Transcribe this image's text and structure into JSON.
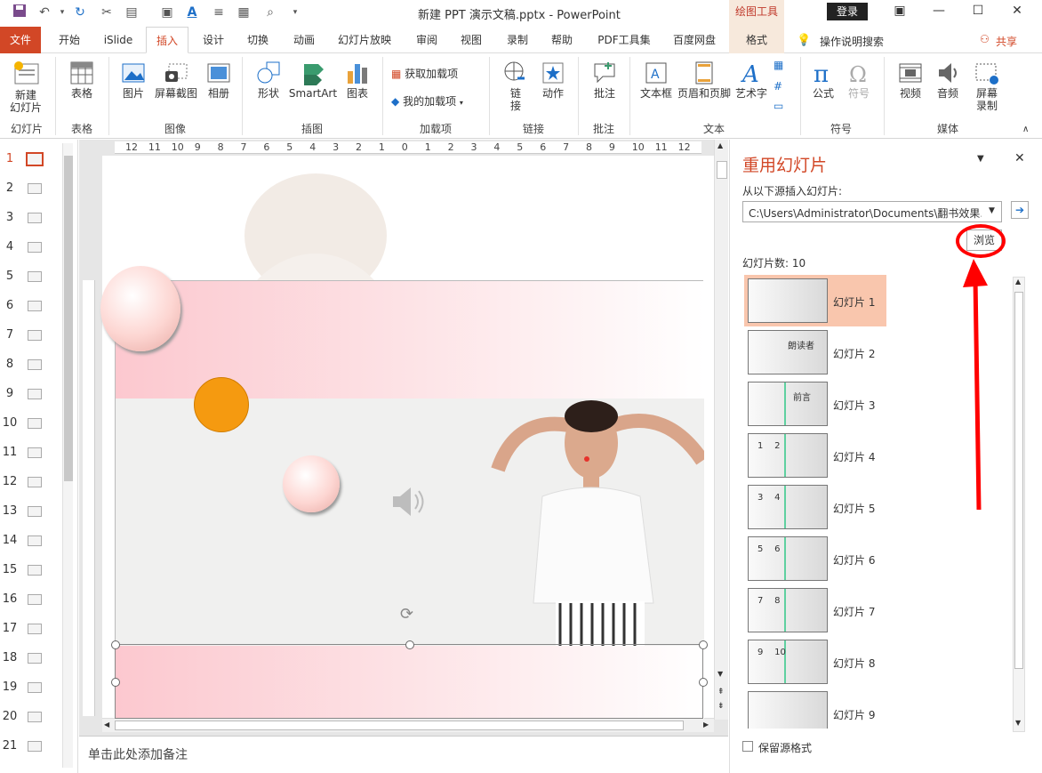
{
  "titlebar": {
    "doc_title": "新建 PPT 演示文稿.pptx  -  PowerPoint",
    "drawing_tools": "绘图工具",
    "login": "登录"
  },
  "tabs": [
    "文件",
    "开始",
    "iSlide",
    "插入",
    "设计",
    "切换",
    "动画",
    "幻灯片放映",
    "审阅",
    "视图",
    "录制",
    "帮助",
    "PDF工具集",
    "百度网盘",
    "格式"
  ],
  "tell_me": "操作说明搜索",
  "share": "共享",
  "ribbon": {
    "new_slide": "新建\n幻灯片",
    "group_slides": "幻灯片",
    "table": "表格",
    "group_table": "表格",
    "picture": "图片",
    "screenshot": "屏幕截图",
    "album": "相册",
    "group_images": "图像",
    "shapes": "形状",
    "smartart": "SmartArt",
    "chart": "图表",
    "group_illustrations": "插图",
    "get_addins": "获取加载项",
    "my_addins": "我的加载项",
    "group_addins": "加载项",
    "link": "链\n接",
    "action": "动作",
    "group_links": "链接",
    "comment": "批注",
    "group_comments": "批注",
    "textbox": "文本框",
    "header_footer": "页眉和页脚",
    "wordart": "艺术字",
    "group_text": "文本",
    "equation": "公式",
    "symbol": "符号",
    "group_symbols": "符号",
    "video": "视频",
    "audio": "音频",
    "screen_rec": "屏幕\n录制",
    "group_media": "媒体"
  },
  "thumbs": [
    "1",
    "2",
    "3",
    "4",
    "5",
    "6",
    "7",
    "8",
    "9",
    "10",
    "11",
    "12",
    "13",
    "14",
    "15",
    "16",
    "17",
    "18",
    "19",
    "20",
    "21"
  ],
  "ruler": [
    "12",
    "11",
    "10",
    "9",
    "8",
    "7",
    "6",
    "5",
    "4",
    "3",
    "2",
    "1",
    "0",
    "1",
    "2",
    "3",
    "4",
    "5",
    "6",
    "7",
    "8",
    "9",
    "10",
    "11",
    "12"
  ],
  "notes_placeholder": "单击此处添加备注",
  "pane": {
    "title": "重用幻灯片",
    "source_label": "从以下源插入幻灯片:",
    "path": "C:\\Users\\Administrator\\Documents\\翻书效果.p",
    "browse": "浏览",
    "count_label": "幻灯片数: 10",
    "keep_format": "保留源格式",
    "slides": [
      {
        "label": "幻灯片 1",
        "text": ""
      },
      {
        "label": "幻灯片 2",
        "text": "朗读者"
      },
      {
        "label": "幻灯片 3",
        "text": "前言"
      },
      {
        "label": "幻灯片 4",
        "text": "1    2"
      },
      {
        "label": "幻灯片 5",
        "text": "3    4"
      },
      {
        "label": "幻灯片 6",
        "text": "5    6"
      },
      {
        "label": "幻灯片 7",
        "text": "7    8"
      },
      {
        "label": "幻灯片 8",
        "text": "9    10"
      },
      {
        "label": "幻灯片 9",
        "text": ""
      }
    ]
  },
  "colors": {
    "accent": "#d24726",
    "annotation": "#ff0000",
    "orange": "#f59a10"
  }
}
